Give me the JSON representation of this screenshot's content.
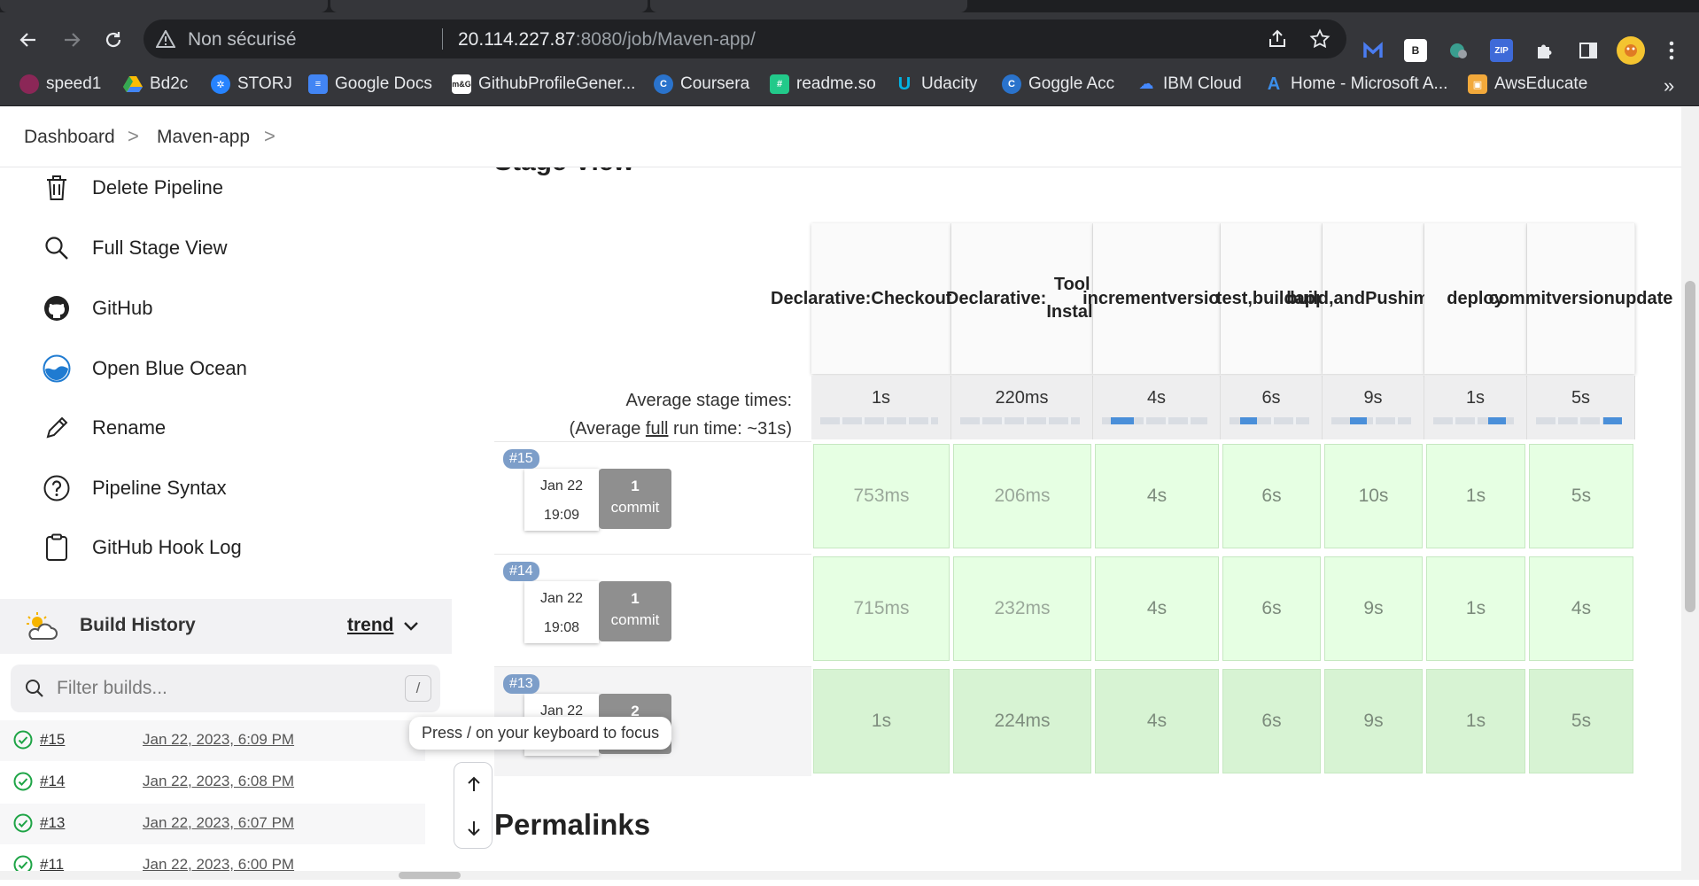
{
  "browser": {
    "security_label": "Non sécurisé",
    "url_host": "20.114.227.87",
    "url_rest": ":8080/job/Maven-app/",
    "bookmarks": [
      "speed1",
      "Bd2c",
      "STORJ",
      "Google Docs",
      "GithubProfileGener...",
      "Coursera",
      "readme.so",
      "Udacity",
      "Goggle Acc",
      "IBM Cloud",
      "Home - Microsoft A...",
      "AwsEducate"
    ],
    "bookmark_overflow": "»",
    "extensions": [
      "malwarebytes-icon",
      "b-extension-icon",
      "translate-icon",
      "zip-icon",
      "puzzle-icon",
      "sidepanel-icon",
      "avatar",
      "more-icon"
    ],
    "colors": {
      "chrome": "#35363a",
      "omnibox": "#202124"
    }
  },
  "breadcrumb": {
    "items": [
      "Dashboard",
      "Maven-app"
    ],
    "separator": ">"
  },
  "sidebar": {
    "tasks": [
      {
        "label": "Delete Pipeline",
        "icon": "trash-icon"
      },
      {
        "label": "Full Stage View",
        "icon": "search-icon"
      },
      {
        "label": "GitHub",
        "icon": "github-icon"
      },
      {
        "label": "Open Blue Ocean",
        "icon": "blue-ocean-icon"
      },
      {
        "label": "Rename",
        "icon": "pencil-icon"
      },
      {
        "label": "Pipeline Syntax",
        "icon": "help-icon"
      },
      {
        "label": "GitHub Hook Log",
        "icon": "clipboard-icon"
      }
    ],
    "build_history": {
      "title": "Build History",
      "trend": "trend",
      "filter_placeholder": "Filter builds...",
      "filter_shortcut": "/",
      "builds": [
        {
          "number": "#15",
          "date": "Jan 22, 2023, 6:09 PM"
        },
        {
          "number": "#14",
          "date": "Jan 22, 2023, 6:08 PM"
        },
        {
          "number": "#13",
          "date": "Jan 22, 2023, 6:07 PM"
        },
        {
          "number": "#11",
          "date": "Jan 22, 2023, 6:00 PM"
        }
      ]
    },
    "tooltip": "Press / on your keyboard to focus"
  },
  "stage_view": {
    "title": "Stage View",
    "avg_label_line1": "Average stage times:",
    "avg_label_pre": "(Average ",
    "avg_label_full": "full",
    "avg_label_post": " run time: ~31s)",
    "stages": [
      {
        "name": "Declarative: Checkout SCM",
        "lines": [
          "Declarative:",
          "Checkout",
          "SCM"
        ],
        "avg": "1s"
      },
      {
        "name": "Declarative: Tool Install",
        "lines": [
          "Declarative:",
          "Tool Install"
        ],
        "avg": "220ms"
      },
      {
        "name": "increment version",
        "lines": [
          "increment",
          "version"
        ],
        "avg": "4s"
      },
      {
        "name": "test, build app",
        "lines": [
          "test,",
          "build",
          "app"
        ],
        "avg": "6s"
      },
      {
        "name": "build, and Push image",
        "lines": [
          "build,",
          "and",
          "Push",
          "image"
        ],
        "avg": "9s"
      },
      {
        "name": "deploy",
        "lines": [
          "deploy"
        ],
        "avg": "1s"
      },
      {
        "name": "commit version update",
        "lines": [
          "commit",
          "version",
          "update"
        ],
        "avg": "5s"
      }
    ],
    "progress": [
      0.0,
      0.0,
      0.3,
      0.35,
      0.45,
      0.9,
      1.0
    ],
    "runs": [
      {
        "badge": "#15",
        "date": "Jan 22",
        "time": "19:09",
        "commits": "1",
        "commit_label": "commit",
        "durations": [
          "753ms",
          "206ms",
          "4s",
          "6s",
          "10s",
          "1s",
          "5s"
        ]
      },
      {
        "badge": "#14",
        "date": "Jan 22",
        "time": "19:08",
        "commits": "1",
        "commit_label": "commit",
        "durations": [
          "715ms",
          "232ms",
          "4s",
          "6s",
          "9s",
          "1s",
          "4s"
        ]
      },
      {
        "badge": "#13",
        "date": "Jan 22",
        "time": "",
        "commits": "2",
        "commit_label": "",
        "durations": [
          "1s",
          "224ms",
          "4s",
          "6s",
          "9s",
          "1s",
          "5s"
        ]
      }
    ]
  },
  "permalinks": {
    "title": "Permalinks"
  }
}
